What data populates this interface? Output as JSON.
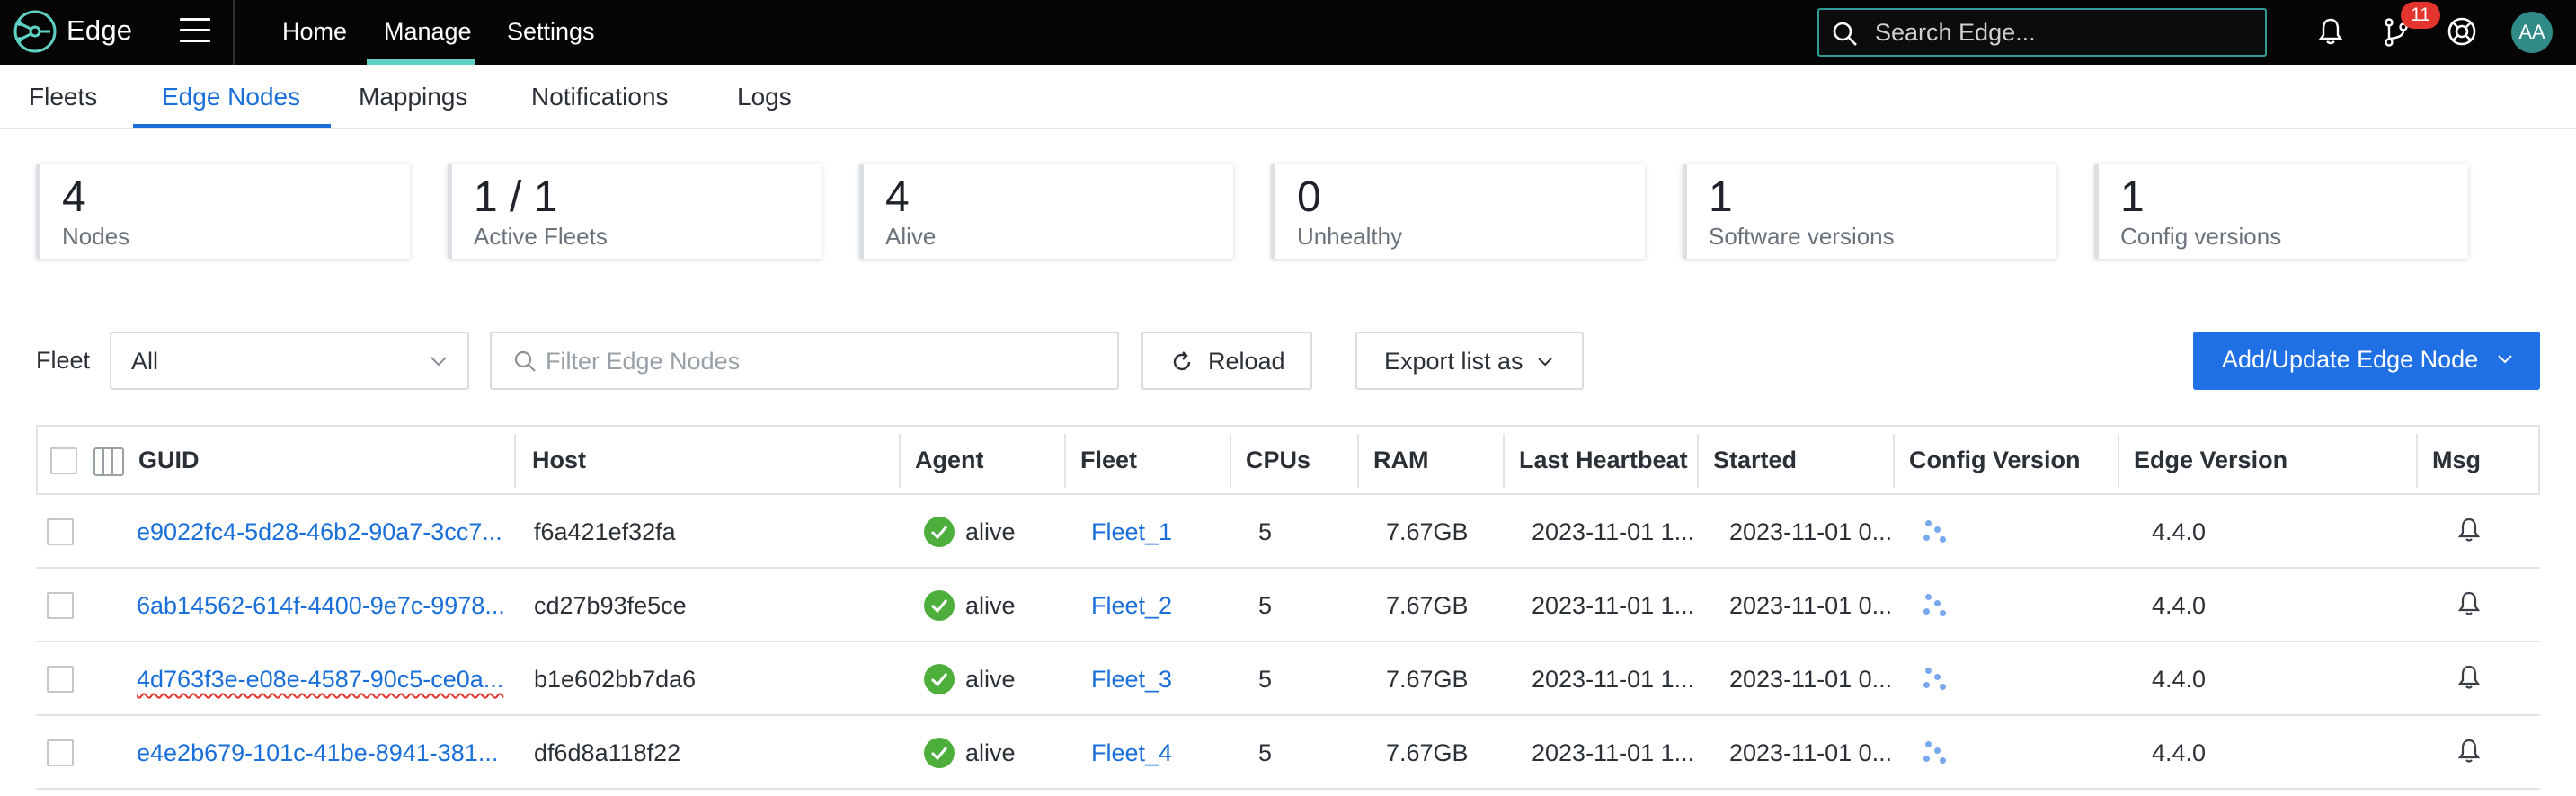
{
  "app": {
    "name": "Edge"
  },
  "topnav": {
    "items": [
      "Home",
      "Manage",
      "Settings"
    ],
    "active": "Manage",
    "search_placeholder": "Search Edge...",
    "notification_count": "11",
    "user_initials": "AA"
  },
  "subtabs": {
    "items": [
      "Fleets",
      "Edge Nodes",
      "Mappings",
      "Notifications",
      "Logs"
    ],
    "active": "Edge Nodes"
  },
  "stats": [
    {
      "value": "4",
      "label": "Nodes"
    },
    {
      "value": "1 / 1",
      "label": "Active Fleets"
    },
    {
      "value": "4",
      "label": "Alive"
    },
    {
      "value": "0",
      "label": "Unhealthy"
    },
    {
      "value": "1",
      "label": "Software versions"
    },
    {
      "value": "1",
      "label": "Config versions"
    }
  ],
  "toolbar": {
    "fleet_label": "Fleet",
    "fleet_value": "All",
    "filter_placeholder": "Filter Edge Nodes",
    "reload_label": "Reload",
    "export_label": "Export list as",
    "add_label": "Add/Update Edge Node"
  },
  "table": {
    "columns": [
      "GUID",
      "Host",
      "Agent",
      "Fleet",
      "CPUs",
      "RAM",
      "Last Heartbeat",
      "Started",
      "Config Version",
      "Edge Version",
      "Msg"
    ],
    "rows": [
      {
        "guid": "e9022fc4-5d28-46b2-90a7-3cc7...",
        "host": "f6a421ef32fa",
        "agent": "alive",
        "fleet": "Fleet_1",
        "cpus": "5",
        "ram": "7.67GB",
        "last_heartbeat": "2023-11-01 1...",
        "started": "2023-11-01 0...",
        "edge_version": "4.4.0"
      },
      {
        "guid": "6ab14562-614f-4400-9e7c-9978...",
        "host": "cd27b93fe5ce",
        "agent": "alive",
        "fleet": "Fleet_2",
        "cpus": "5",
        "ram": "7.67GB",
        "last_heartbeat": "2023-11-01 1...",
        "started": "2023-11-01 0...",
        "edge_version": "4.4.0"
      },
      {
        "guid": "4d763f3e-e08e-4587-90c5-ce0a...",
        "host": "b1e602bb7da6",
        "agent": "alive",
        "fleet": "Fleet_3",
        "cpus": "5",
        "ram": "7.67GB",
        "last_heartbeat": "2023-11-01 1...",
        "started": "2023-11-01 0...",
        "edge_version": "4.4.0"
      },
      {
        "guid": "e4e2b679-101c-41be-8941-381...",
        "host": "df6d8a118f22",
        "agent": "alive",
        "fleet": "Fleet_4",
        "cpus": "5",
        "ram": "7.67GB",
        "last_heartbeat": "2023-11-01 1...",
        "started": "2023-11-01 0...",
        "edge_version": "4.4.0"
      }
    ]
  },
  "colors": {
    "topbar_bg": "#050505",
    "accent_teal": "#5fd1c4",
    "link_blue": "#1a6fd8",
    "primary_button": "#1f6fe5",
    "alive_green": "#4eae3b",
    "badge_red": "#e4342e"
  },
  "icons": [
    "edge-logo-icon",
    "menu-icon",
    "search-icon",
    "bell-icon",
    "merge-request-icon",
    "help-icon",
    "chevron-down-icon",
    "reload-icon",
    "column-picker-icon",
    "check-circle-icon",
    "config-dots-icon"
  ]
}
